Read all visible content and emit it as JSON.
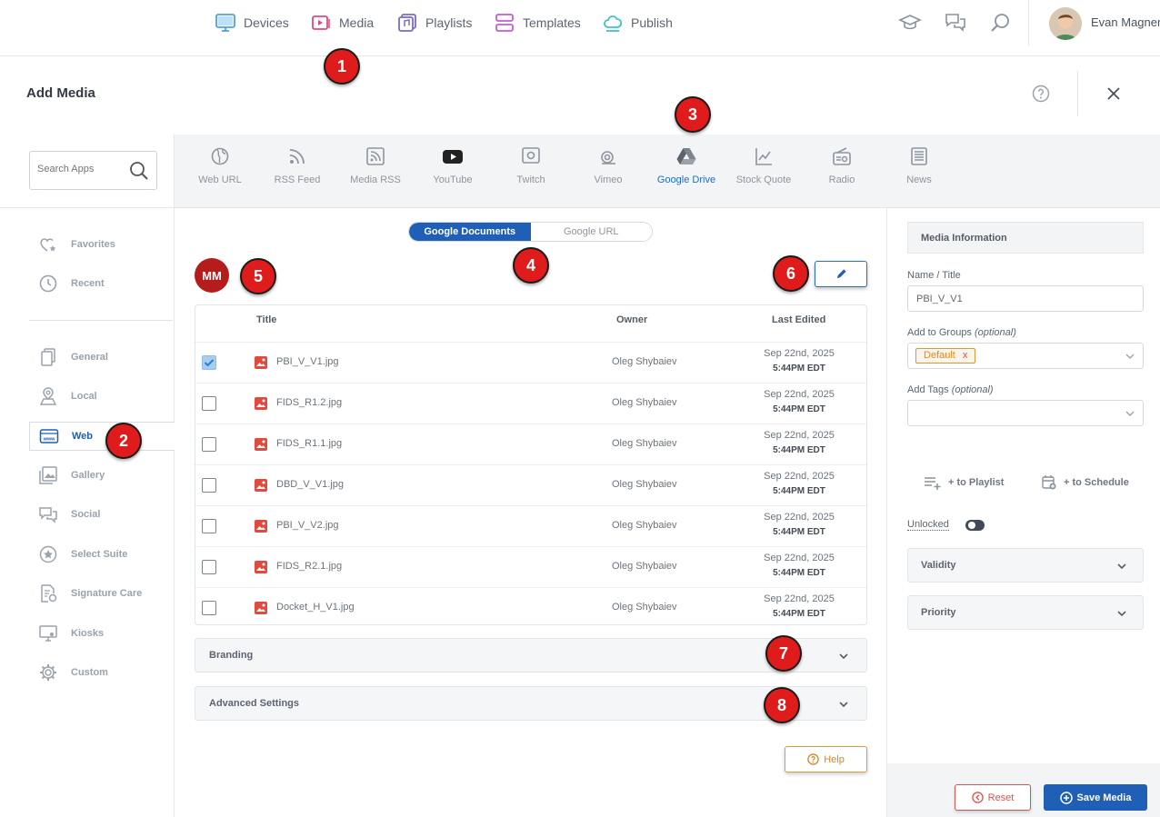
{
  "topnav": {
    "items": [
      {
        "label": "Devices",
        "icon": "monitor-icon",
        "color": "#4aa3df"
      },
      {
        "label": "Media",
        "icon": "play-icon",
        "color": "#e3487a"
      },
      {
        "label": "Playlists",
        "icon": "playlist-icon",
        "color": "#7b6ac9"
      },
      {
        "label": "Templates",
        "icon": "templates-icon",
        "color": "#c45bd6"
      },
      {
        "label": "Publish",
        "icon": "cloud-icon",
        "color": "#3fc1c9"
      }
    ],
    "user_name": "Evan Magner"
  },
  "dialog": {
    "title": "Add Media"
  },
  "badges": [
    "1",
    "2",
    "3",
    "4",
    "5",
    "6",
    "7",
    "8"
  ],
  "left": {
    "search_placeholder": "Search Apps",
    "top_items": [
      {
        "label": "Favorites",
        "icon": "heart-star-icon"
      },
      {
        "label": "Recent",
        "icon": "clock-icon"
      }
    ],
    "items": [
      {
        "label": "General",
        "icon": "documents-icon"
      },
      {
        "label": "Local",
        "icon": "location-icon"
      },
      {
        "label": "Web",
        "icon": "www-icon",
        "active": true
      },
      {
        "label": "Gallery",
        "icon": "gallery-icon"
      },
      {
        "label": "Social",
        "icon": "social-icon"
      },
      {
        "label": "Select Suite",
        "icon": "star-circle-icon"
      },
      {
        "label": "Signature Care",
        "icon": "signature-icon"
      },
      {
        "label": "Kiosks",
        "icon": "kiosk-icon"
      },
      {
        "label": "Custom",
        "icon": "gear-icon"
      }
    ]
  },
  "apps": [
    {
      "label": "Web URL",
      "icon": "globe-icon"
    },
    {
      "label": "RSS Feed",
      "icon": "rss-icon"
    },
    {
      "label": "Media RSS",
      "icon": "media-rss-icon"
    },
    {
      "label": "YouTube",
      "icon": "youtube-icon"
    },
    {
      "label": "Twitch",
      "icon": "twitch-icon"
    },
    {
      "label": "Vimeo",
      "icon": "vimeo-icon"
    },
    {
      "label": "Google Drive",
      "icon": "google-drive-icon",
      "active": true
    },
    {
      "label": "Stock Quote",
      "icon": "chart-icon"
    },
    {
      "label": "Radio",
      "icon": "radio-icon"
    },
    {
      "label": "News",
      "icon": "news-icon"
    }
  ],
  "toggle": {
    "on": "Google Documents",
    "off": "Google URL"
  },
  "account": {
    "initials": "MM"
  },
  "table": {
    "headers": {
      "title": "Title",
      "owner": "Owner",
      "edited": "Last Edited"
    },
    "rows": [
      {
        "name": "PBI_V_V1.jpg",
        "owner": "Oleg Shybaiev",
        "date": "Sep 22nd, 2025",
        "time": "5:44PM EDT",
        "checked": true
      },
      {
        "name": "FIDS_R1.2.jpg",
        "owner": "Oleg Shybaiev",
        "date": "Sep 22nd, 2025",
        "time": "5:44PM EDT",
        "checked": false
      },
      {
        "name": "FIDS_R1.1.jpg",
        "owner": "Oleg Shybaiev",
        "date": "Sep 22nd, 2025",
        "time": "5:44PM EDT",
        "checked": false
      },
      {
        "name": "DBD_V_V1.jpg",
        "owner": "Oleg Shybaiev",
        "date": "Sep 22nd, 2025",
        "time": "5:44PM EDT",
        "checked": false
      },
      {
        "name": "PBI_V_V2.jpg",
        "owner": "Oleg Shybaiev",
        "date": "Sep 22nd, 2025",
        "time": "5:44PM EDT",
        "checked": false
      },
      {
        "name": "FIDS_R2.1.jpg",
        "owner": "Oleg Shybaiev",
        "date": "Sep 22nd, 2025",
        "time": "5:44PM EDT",
        "checked": false
      },
      {
        "name": "Docket_H_V1.jpg",
        "owner": "Oleg Shybaiev",
        "date": "Sep 22nd, 2025",
        "time": "5:44PM EDT",
        "checked": false
      }
    ]
  },
  "sections": {
    "branding": "Branding",
    "advanced": "Advanced Settings"
  },
  "help_label": "Help",
  "right": {
    "header": "Media Information",
    "name_label": "Name / Title",
    "name_value": "PBI_V_V1",
    "groups_label": "Add to Groups",
    "groups_optional": "(optional)",
    "group_tag": "Default",
    "tag_remove": "x",
    "tags_label": "Add Tags",
    "tags_optional": "(optional)",
    "to_playlist": "+ to Playlist",
    "to_schedule": "+ to Schedule",
    "unlocked": "Unlocked",
    "validity": "Validity",
    "priority": "Priority"
  },
  "footer": {
    "reset": "Reset",
    "save": "Save Media"
  }
}
